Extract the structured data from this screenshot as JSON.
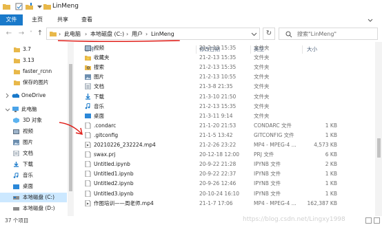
{
  "titlebar": {
    "title": "LinMeng",
    "quick_access_icons": [
      "folder-icon",
      "properties-icon",
      "new-folder-icon",
      "dropdown-icon"
    ]
  },
  "ribbon": {
    "tabs": [
      {
        "label": "文件"
      },
      {
        "label": "主页"
      },
      {
        "label": "共享"
      },
      {
        "label": "查看"
      }
    ]
  },
  "address": {
    "breadcrumbs": [
      {
        "label": "此电脑"
      },
      {
        "label": "本地磁盘 (C:)"
      },
      {
        "label": "用户"
      },
      {
        "label": "LinMeng"
      }
    ],
    "separator": "›",
    "search_placeholder": "搜索\"LinMeng\""
  },
  "sidebar": {
    "items": [
      {
        "label": "3.7",
        "icon": "folder-icon"
      },
      {
        "label": "3.13",
        "icon": "folder-icon"
      },
      {
        "label": "faster_rcnn",
        "icon": "folder-icon"
      },
      {
        "label": "保存的图片",
        "icon": "folder-icon"
      },
      {
        "label": "OneDrive",
        "icon": "onedrive-icon"
      },
      {
        "label": "此电脑",
        "icon": "this-pc-icon"
      },
      {
        "label": "3D 对象",
        "icon": "3d-objects-icon"
      },
      {
        "label": "视频",
        "icon": "video-folder-icon"
      },
      {
        "label": "图片",
        "icon": "pictures-folder-icon"
      },
      {
        "label": "文档",
        "icon": "documents-folder-icon"
      },
      {
        "label": "下载",
        "icon": "downloads-folder-icon"
      },
      {
        "label": "音乐",
        "icon": "music-folder-icon"
      },
      {
        "label": "桌面",
        "icon": "desktop-folder-icon"
      },
      {
        "label": "本地磁盘 (C:)",
        "icon": "drive-icon"
      },
      {
        "label": "本地磁盘 (D:)",
        "icon": "drive-icon"
      }
    ],
    "selected": "本地磁盘 (C:)"
  },
  "file_list": {
    "columns": {
      "name": "名称",
      "date": "修改日期",
      "type": "类型",
      "size": "大小"
    },
    "rows": [
      {
        "name": "视频",
        "date": "21-2-13 15:35",
        "type": "文件夹",
        "size": "",
        "icon": "video-folder-icon"
      },
      {
        "name": "收藏夹",
        "date": "21-2-13 15:35",
        "type": "文件夹",
        "size": "",
        "icon": "favorites-folder-icon"
      },
      {
        "name": "搜索",
        "date": "21-2-13 15:35",
        "type": "文件夹",
        "size": "",
        "icon": "search-folder-icon"
      },
      {
        "name": "图片",
        "date": "21-2-13 10:55",
        "type": "文件夹",
        "size": "",
        "icon": "pictures-folder-icon"
      },
      {
        "name": "文档",
        "date": "21-3-8 21:35",
        "type": "文件夹",
        "size": "",
        "icon": "documents-folder-icon"
      },
      {
        "name": "下载",
        "date": "21-3-10 21:50",
        "type": "文件夹",
        "size": "",
        "icon": "downloads-folder-icon"
      },
      {
        "name": "音乐",
        "date": "21-2-13 15:35",
        "type": "文件夹",
        "size": "",
        "icon": "music-folder-icon"
      },
      {
        "name": "桌面",
        "date": "21-3-11 9:14",
        "type": "文件夹",
        "size": "",
        "icon": "desktop-folder-icon"
      },
      {
        "name": ".condarc",
        "date": "21-1-20 21:53",
        "type": "CONDARC 文件",
        "size": "1 KB",
        "icon": "file-icon"
      },
      {
        "name": ".gitconfig",
        "date": "21-1-5 13:42",
        "type": "GITCONFIG 文件",
        "size": "1 KB",
        "icon": "file-icon"
      },
      {
        "name": "20210226_232224.mp4",
        "date": "21-2-26 23:22",
        "type": "MP4 - MPEG-4 ...",
        "size": "4,573 KB",
        "icon": "video-file-icon"
      },
      {
        "name": "swax.prj",
        "date": "20-12-18 12:00",
        "type": "PRJ 文件",
        "size": "6 KB",
        "icon": "file-icon"
      },
      {
        "name": "Untitled.ipynb",
        "date": "20-9-22 21:28",
        "type": "IPYNB 文件",
        "size": "2 KB",
        "icon": "file-icon"
      },
      {
        "name": "Untitled1.ipynb",
        "date": "20-9-22 22:37",
        "type": "IPYNB 文件",
        "size": "1 KB",
        "icon": "file-icon"
      },
      {
        "name": "Untitled2.ipynb",
        "date": "20-9-26 12:46",
        "type": "IPYNB 文件",
        "size": "1 KB",
        "icon": "file-icon"
      },
      {
        "name": "Untitled3.ipynb",
        "date": "20-10-24 16:10",
        "type": "IPYNB 文件",
        "size": "1 KB",
        "icon": "file-icon"
      },
      {
        "name": "作图培训——周老师.mp4",
        "date": "21-1-7 17:06",
        "type": "MP4 - MPEG-4 ...",
        "size": "162,387 KB",
        "icon": "video-file-icon"
      }
    ]
  },
  "status": {
    "item_count": "37 个项目",
    "watermark": "https://blog.csdn.net/Lingxy1998"
  },
  "colors": {
    "accent": "#1979ca",
    "selected": "#cce8ff",
    "folder": "#e8b84a",
    "annotation": "#e0201b"
  }
}
